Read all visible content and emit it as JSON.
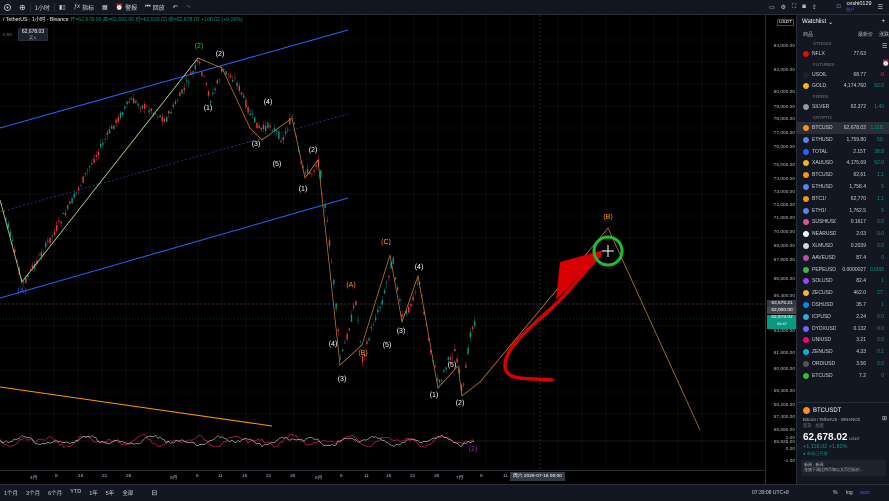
{
  "toolbar": {
    "interval": "1小时",
    "indicators": "指标",
    "alert": "警报",
    "replay": "回放",
    "user": "ceshi0129",
    "user_sub": "账户"
  },
  "legend": {
    "symbol": "/ TetherUS · 1小时 · Binance",
    "ohlc": "开=62,678.00 高=62,692.00 低=62,529.03 收=62,678.02 +100.02 (+0.16%)"
  },
  "badge": {
    "price": "62,678.03",
    "sub": "买入"
  },
  "price_axis": {
    "currency": "USDT",
    "labels": [
      "84,000.00",
      "82,000.00",
      "80,000.00",
      "79,000.00",
      "78,000.00",
      "77,000.00",
      "76,000.00",
      "75,000.00",
      "74,000.00",
      "73,000.00",
      "72,000.00",
      "71,000.00",
      "70,000.00",
      "69,000.00",
      "67,800.00",
      "66,600.00",
      "65,400.00",
      "64,200.00",
      "63,000.00",
      "61,800.00",
      "60,600.00",
      "59,400.00",
      "58,200.00",
      "57,400.00",
      "56,650.00",
      "55,925.00"
    ],
    "tag_cursor": "63,676.21",
    "tag_last": "62,678.02",
    "tag_last_sub": "06:47",
    "tag_prev": "62,000.00",
    "osc_labels": [
      "1.00",
      "0.00",
      "-1.00"
    ]
  },
  "time_axis": {
    "labels": [
      "4月",
      "8",
      "16",
      "21",
      "26",
      "5月",
      "6",
      "11",
      "16",
      "21",
      "26",
      "6月",
      "6",
      "11",
      "16",
      "21",
      "26",
      "7月",
      "6",
      "11"
    ],
    "cursor_date": "周六 2026-07-18  09:00"
  },
  "waves": {
    "blue": [
      "(A)"
    ],
    "green": [
      "(2)"
    ],
    "white": [
      "(2)",
      "(1)",
      "(4)",
      "(3)",
      "(5)",
      "(1)",
      "(2)",
      "(4)",
      "(3)",
      "(5)",
      "(1)",
      "(2)",
      "(4)",
      "(3)",
      "(5)"
    ],
    "orange": [
      "(C)",
      "(A)",
      "(B)",
      "(B)"
    ],
    "purple": [
      "(2)"
    ]
  },
  "bottom": {
    "ranges": [
      "1个月",
      "3个月",
      "6个月",
      "YTD",
      "1年",
      "5年",
      "全部"
    ],
    "clock": "07:39:08 UTC+8"
  },
  "watchlist": {
    "title": "Watchlist",
    "col_symbol": "商品",
    "col_last": "最新价",
    "col_change": "涨跌",
    "sections": [
      "STOCKS",
      "FUTURES",
      "FOREX",
      "CRYPTO"
    ],
    "rows_stocks": [
      {
        "sym": "NFLX",
        "last": "77.63",
        "chg": "",
        "color": "#e50914"
      }
    ],
    "rows_futures": [
      {
        "sym": "USOIL",
        "last": "68.77",
        "chg": "-0",
        "color": "#1e222d"
      },
      {
        "sym": "GOLD",
        "last": "4,174.760",
        "chg": "52.0",
        "color": "#f0b90b"
      }
    ],
    "rows_forex": [
      {
        "sym": "SILVER",
        "last": "62.372",
        "chg": "1.40",
        "color": "#9598a1"
      }
    ],
    "rows_crypto": [
      {
        "sym": "BTCUSD",
        "last": "62,678.02",
        "chg": "1,118.",
        "color": "#f7931a",
        "sel": true
      },
      {
        "sym": "ETHUSD",
        "last": "1,759.80",
        "chg": "59.",
        "color": "#627eea"
      },
      {
        "sym": "TOTAL",
        "last": "2.15T",
        "chg": "38.8",
        "color": "#2962ff"
      },
      {
        "sym": "XAUUSD",
        "last": "4,175.69",
        "chg": "52.0",
        "color": "#f0b90b"
      },
      {
        "sym": "BTCUSD",
        "last": "62,61",
        "chg": "1,1",
        "color": "#f7931a"
      },
      {
        "sym": "ETHUSD",
        "last": "1,758.4",
        "chg": "5",
        "color": "#627eea"
      },
      {
        "sym": "BTC1!",
        "last": "62,770",
        "chg": "1,1",
        "color": "#f7931a"
      },
      {
        "sym": "ETH1!",
        "last": "1,762.5",
        "chg": "5",
        "color": "#627eea"
      },
      {
        "sym": "SUSHIUSD",
        "last": "0.1617",
        "chg": "0.0",
        "color": "#d65892"
      },
      {
        "sym": "NEARUSD",
        "last": "2.03",
        "chg": "0.0",
        "color": "#ffffff"
      },
      {
        "sym": "XLMUSD",
        "last": "0.2039",
        "chg": "0.0",
        "color": "#cfd8dc"
      },
      {
        "sym": "AAVEUSD",
        "last": "87.4",
        "chg": "0",
        "color": "#b6509e"
      },
      {
        "sym": "PEPEUSD",
        "last": "0.0000027",
        "chg": "0.0000",
        "color": "#4caf50"
      },
      {
        "sym": "SOLUSD",
        "last": "82.4",
        "chg": "1",
        "color": "#9945ff"
      },
      {
        "sym": "ZECUSD",
        "last": "462.0",
        "chg": "27.",
        "color": "#f4b728"
      },
      {
        "sym": "DSHUSD",
        "last": "35.7",
        "chg": "1",
        "color": "#008ce7"
      },
      {
        "sym": "ICPUSD",
        "last": "2.24",
        "chg": "0.0",
        "color": "#29abe2"
      },
      {
        "sym": "DYDXUSD",
        "last": "0.132",
        "chg": "0.0",
        "color": "#6966ff"
      },
      {
        "sym": "UNIUSD",
        "last": "3.21",
        "chg": "0.0",
        "color": "#ff007a"
      },
      {
        "sym": "ZENUSD",
        "last": "4.33",
        "chg": "0.1",
        "color": "#00b4d8"
      },
      {
        "sym": "ORDIUSD",
        "last": "3.56",
        "chg": "0.0",
        "color": "#555555"
      },
      {
        "sym": "ETCUSD",
        "last": "7.2",
        "chg": "0",
        "color": "#3ab83a"
      }
    ],
    "detail_symbol": "BTCUSDT",
    "detail_name": "Bitcoin / TetherUS",
    "detail_exchange": "BINANCE",
    "detail_type": "现货 · 加密",
    "detail_price": "62,678.02",
    "detail_unit": "USDT",
    "detail_change": "+1,118.02",
    "detail_pct": "+1.82%",
    "detail_market": "市场已开放",
    "news_title": "新闻 · 新闻",
    "news_text": "花旗下调比特币和以太币目标价..."
  },
  "colors": {
    "up": "#089981",
    "down": "#f23645",
    "blue": "#2962ff",
    "orange": "#ff9800",
    "green": "#4caf50",
    "bg": "#000000"
  }
}
